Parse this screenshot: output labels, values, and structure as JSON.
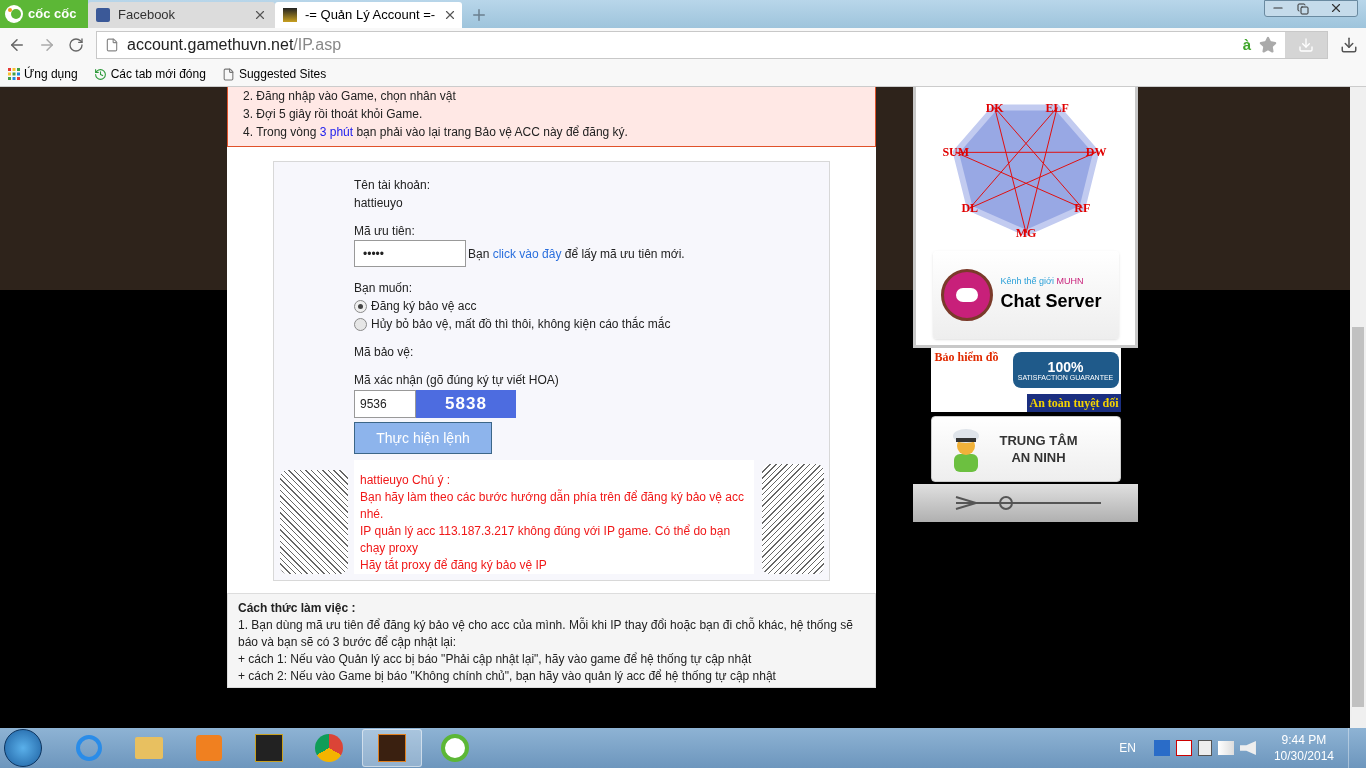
{
  "browser": {
    "brand": "cốc cốc",
    "tabs": [
      {
        "label": "Facebook",
        "selected": false
      },
      {
        "label": "-= Quản Lý Account =-",
        "selected": true
      }
    ],
    "url": {
      "host": "account.gamethuvn.net",
      "path": "/IP.asp"
    },
    "typing_mark": "à",
    "bookmarks": [
      "Ứng dụng",
      "Các tab mới đóng",
      "Suggested Sites"
    ]
  },
  "notice": {
    "lines": [
      {
        "text": "2. Đăng nhập vào Game, chọn nhân vật"
      },
      {
        "text": "3. Đợi 5 giây rồi thoát khỏi Game."
      },
      {
        "text": "4. Trong vòng ",
        "link": "3 phút",
        "after": " bạn phải vào lại trang Bảo vệ ACC này để đăng ký."
      }
    ]
  },
  "form": {
    "account_label": "Tên tài khoản:",
    "account_value": "hattieuyo",
    "priority_label": "Mã ưu tiên:",
    "priority_value": "•••••",
    "hint": {
      "before": "Bạn ",
      "link": "click vào đây",
      "after": " để lấy mã ưu tiên mới."
    },
    "choice_label": "Bạn muốn:",
    "options": [
      {
        "label": "Đăng ký bảo vệ acc",
        "selected": true
      },
      {
        "label": "Hủy bỏ bảo vệ, mất đồ thì thôi, không kiện cáo thắc mắc",
        "selected": false
      }
    ],
    "protect_label": "Mã bảo vệ:",
    "captcha_label": "Mã xác nhận (gõ đúng ký tự viết HOA)",
    "captcha_value": "9536",
    "captcha_text": "5838",
    "submit": "Thực hiện lệnh"
  },
  "messages": {
    "title": "hattieuyo Chú ý :",
    "lines": [
      "Bạn hãy làm theo các bước hướng dẫn phía trên để đăng ký bảo vệ acc nhé.",
      "IP quản lý acc 113.187.3.217 không đúng với IP game. Có thể do bạn chạy proxy",
      "Hãy tắt proxy để đăng ký bảo vệ IP"
    ]
  },
  "instructions": {
    "title": "Cách thức làm việc :",
    "lines": [
      "1. Bạn dùng mã ưu tiên để đăng ký bảo vệ cho acc của mình. Mỗi khi IP thay đổi hoặc bạn đi chỗ khác, hệ thống sẽ báo và bạn sẽ có 3 bước để cập nhật lại:",
      "+ cách 1: Nếu vào Quản lý acc bị báo \"Phải cập nhật lại\", hãy vào game để hệ thống tự cập nhật",
      "+ cách 2: Nếu vào Game bị báo \"Không chính chủ\", bạn hãy vào quản lý acc để hệ thống tự cập nhật"
    ]
  },
  "sidebar": {
    "diagram_labels": [
      "DK",
      "ELF",
      "DW",
      "RF",
      "MG",
      "DL",
      "SUM"
    ],
    "chat": {
      "caption": "Kênh thế giới ",
      "caption_highlight": "MUHN",
      "title": "Chat Server"
    },
    "insurance": {
      "title": "Bảo hiểm đồ",
      "seal": "100%",
      "seal_caption": "SATISFACTION GUARANTEE",
      "motto": "An toàn tuyệt đối"
    },
    "security": {
      "line_1": "TRUNG TÂM",
      "line_2": "AN NINH"
    }
  },
  "taskbar": {
    "language": "EN",
    "time": "9:44 PM",
    "date": "10/30/2014"
  }
}
